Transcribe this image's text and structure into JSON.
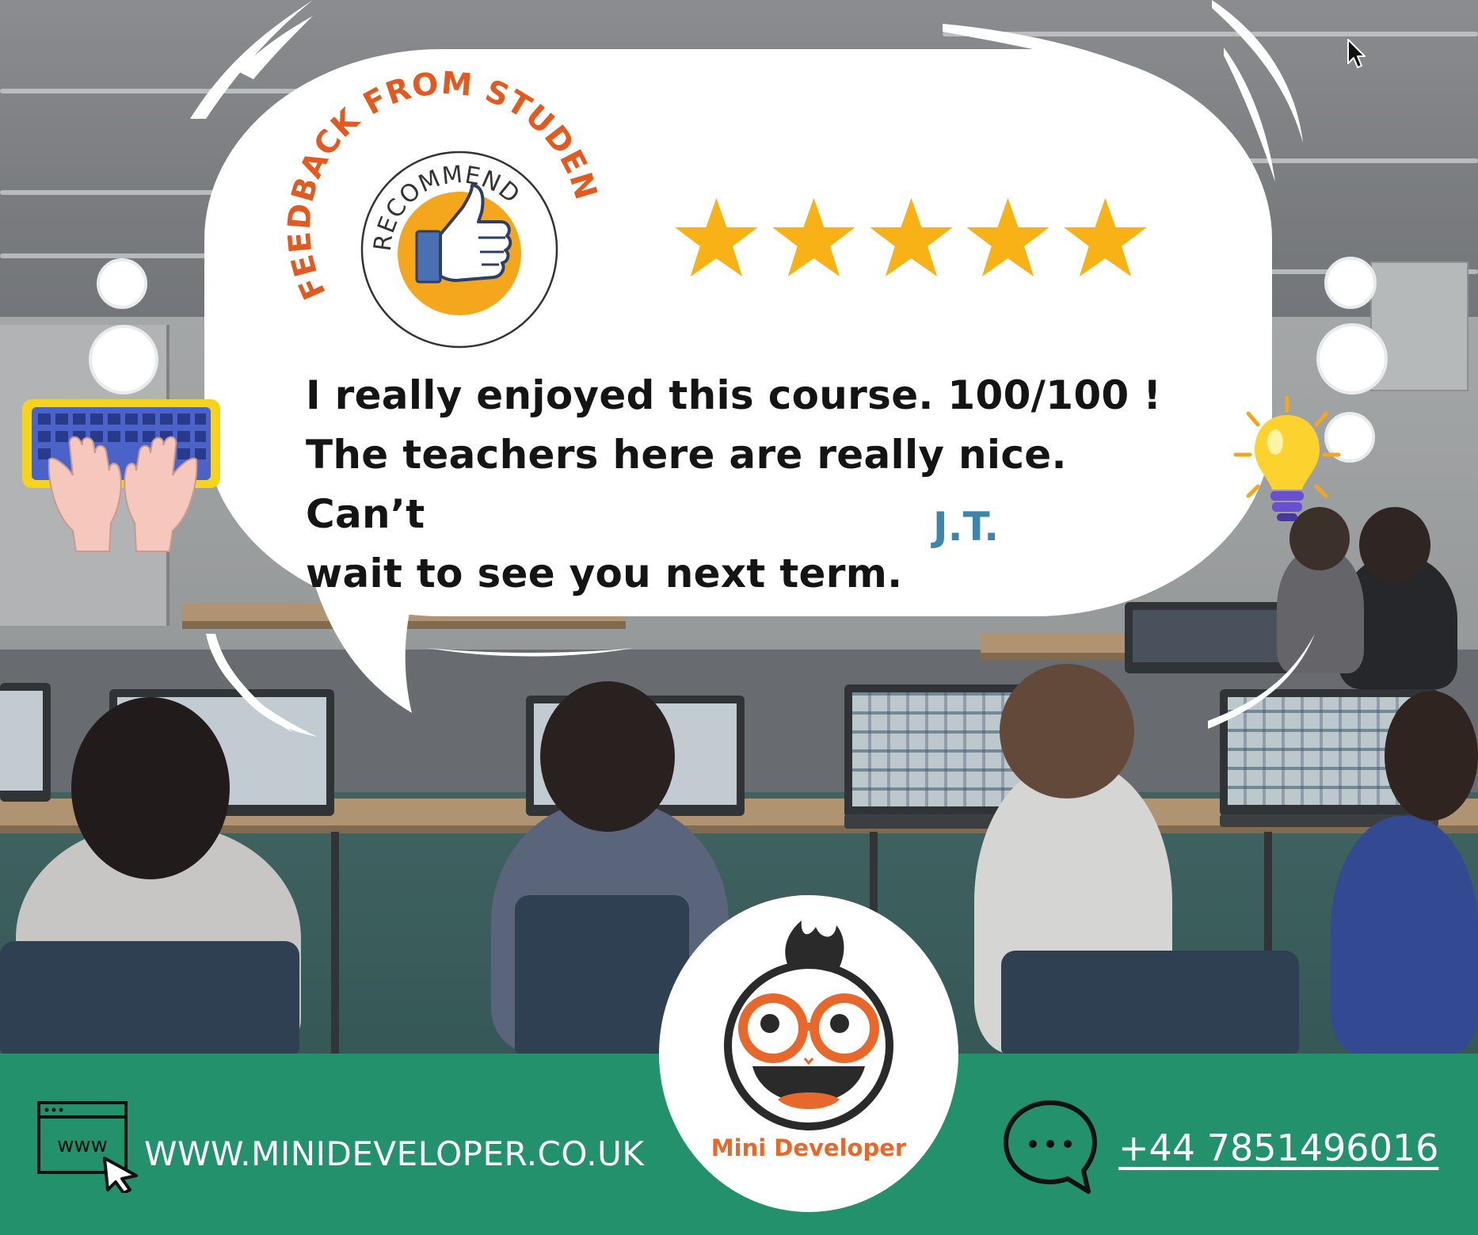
{
  "header": {
    "arc_title": "FEEDBACK FROM STUDENTS",
    "badge_label": "RECOMMEND"
  },
  "rating": {
    "stars": 5,
    "max": 5,
    "color": "#f8b216"
  },
  "testimonial": {
    "lines": [
      "I really enjoyed this course. 100/100 !",
      "The teachers here are really nice. Can’t",
      "wait to see you next term."
    ],
    "author": "J.T."
  },
  "brand": {
    "name": "Mini Developer",
    "accent": "#e8682c",
    "footer_color": "#22916c"
  },
  "contact": {
    "website": "WWW.MINIDEVELOPER.CO.UK",
    "www_icon_label": "www",
    "phone": "+44 7851496016"
  },
  "icons": [
    "thumbs-up-icon",
    "star-icon",
    "keyboard-hands-icon",
    "lightbulb-icon",
    "www-browser-icon",
    "chat-bubble-icon",
    "mouse-cursor-icon"
  ]
}
